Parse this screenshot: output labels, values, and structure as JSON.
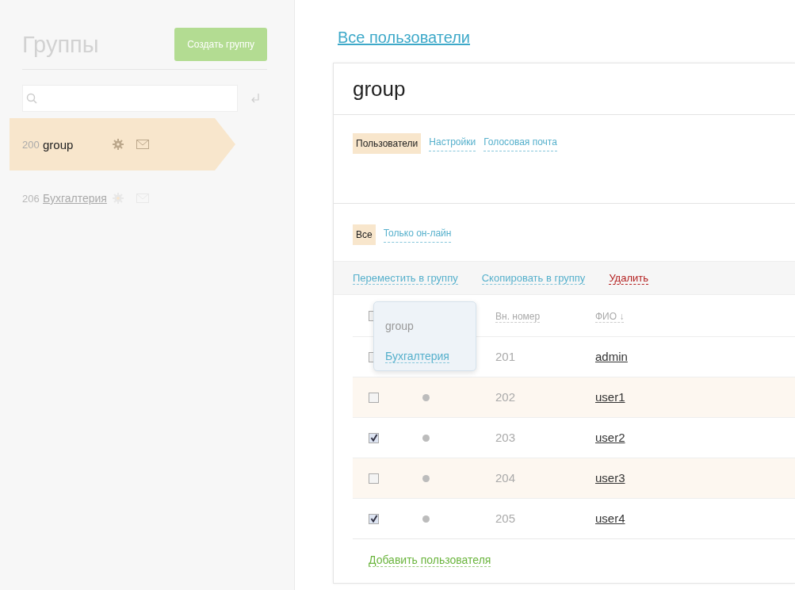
{
  "sidebar": {
    "title": "Группы",
    "create_button": "Создать группу",
    "groups": [
      {
        "number": "200",
        "name": "group",
        "selected": true
      },
      {
        "number": "206",
        "name": "Бухгалтерия",
        "selected": false
      }
    ]
  },
  "main": {
    "breadcrumb": "Все пользователи",
    "title": "group",
    "tabs": [
      {
        "label": "Пользователи",
        "selected": true
      },
      {
        "label": "Настройки",
        "selected": false
      },
      {
        "label": "Голосовая почта",
        "selected": false
      }
    ],
    "filters": [
      {
        "label": "Все",
        "selected": true
      },
      {
        "label": "Только он-лайн",
        "selected": false
      }
    ],
    "actions": [
      {
        "label": "Переместить в группу",
        "kind": "link"
      },
      {
        "label": "Скопировать в группу",
        "kind": "link"
      },
      {
        "label": "Удалить",
        "kind": "danger"
      }
    ],
    "popup": {
      "items": [
        {
          "label": "group",
          "disabled": true
        },
        {
          "label": "Бухгалтерия",
          "disabled": false
        }
      ]
    },
    "table": {
      "select_all_checked": false,
      "columns": [
        "Вн. номер",
        "ФИО ↓"
      ],
      "rows": [
        {
          "checked": false,
          "number": "201",
          "name": "admin"
        },
        {
          "checked": false,
          "online": false,
          "number": "202",
          "name": "user1"
        },
        {
          "checked": true,
          "online": false,
          "number": "203",
          "name": "user2"
        },
        {
          "checked": false,
          "online": false,
          "number": "204",
          "name": "user3"
        },
        {
          "checked": true,
          "online": false,
          "number": "205",
          "name": "user4"
        }
      ]
    },
    "add_user": "Добавить пользователя"
  }
}
